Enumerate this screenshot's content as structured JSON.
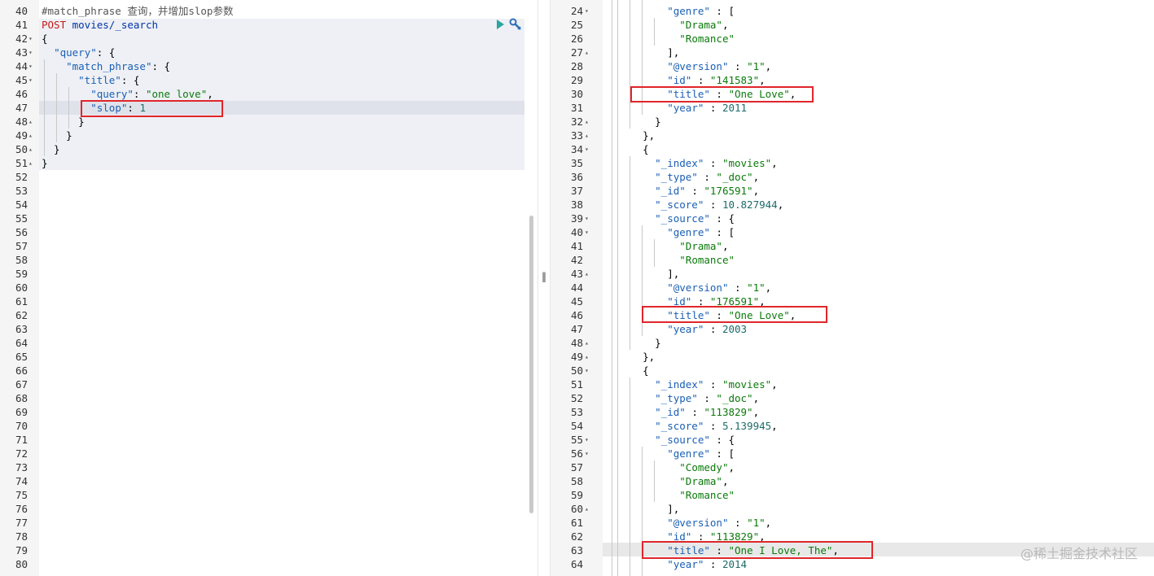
{
  "request_editor": {
    "lines": [
      {
        "n": "40",
        "fold": "",
        "tokens": [
          {
            "t": "#match_phrase 查询，并增加slop参数",
            "c": "comment"
          }
        ]
      },
      {
        "n": "41",
        "fold": "",
        "tokens": [
          {
            "t": "POST",
            "c": "method"
          },
          {
            "t": " movies/_search",
            "c": "url"
          }
        ]
      },
      {
        "n": "42",
        "fold": "▾",
        "tokens": [
          {
            "t": "{",
            "c": "plain"
          }
        ]
      },
      {
        "n": "43",
        "fold": "▾",
        "tokens": [
          {
            "t": "  ",
            "c": "plain"
          },
          {
            "t": "\"query\"",
            "c": "key"
          },
          {
            "t": ": {",
            "c": "plain"
          }
        ]
      },
      {
        "n": "44",
        "fold": "▾",
        "tokens": [
          {
            "t": "    ",
            "c": "plain"
          },
          {
            "t": "\"match_phrase\"",
            "c": "key"
          },
          {
            "t": ": {",
            "c": "plain"
          }
        ]
      },
      {
        "n": "45",
        "fold": "▾",
        "tokens": [
          {
            "t": "      ",
            "c": "plain"
          },
          {
            "t": "\"title\"",
            "c": "key"
          },
          {
            "t": ": {",
            "c": "plain"
          }
        ]
      },
      {
        "n": "46",
        "fold": "",
        "tokens": [
          {
            "t": "        ",
            "c": "plain"
          },
          {
            "t": "\"query\"",
            "c": "key"
          },
          {
            "t": ": ",
            "c": "plain"
          },
          {
            "t": "\"one love\"",
            "c": "str"
          },
          {
            "t": ",",
            "c": "plain"
          }
        ]
      },
      {
        "n": "47",
        "fold": "",
        "tokens": [
          {
            "t": "        ",
            "c": "plain"
          },
          {
            "t": "\"slop\"",
            "c": "key"
          },
          {
            "t": ": ",
            "c": "plain"
          },
          {
            "t": "1",
            "c": "num"
          }
        ]
      },
      {
        "n": "48",
        "fold": "▴",
        "tokens": [
          {
            "t": "      }",
            "c": "plain"
          }
        ]
      },
      {
        "n": "49",
        "fold": "▴",
        "tokens": [
          {
            "t": "    }",
            "c": "plain"
          }
        ]
      },
      {
        "n": "50",
        "fold": "▴",
        "tokens": [
          {
            "t": "  }",
            "c": "plain"
          }
        ]
      },
      {
        "n": "51",
        "fold": "▴",
        "tokens": [
          {
            "t": "}",
            "c": "plain"
          }
        ]
      },
      {
        "n": "52",
        "fold": "",
        "tokens": []
      },
      {
        "n": "53",
        "fold": "",
        "tokens": []
      },
      {
        "n": "54",
        "fold": "",
        "tokens": []
      },
      {
        "n": "55",
        "fold": "",
        "tokens": []
      },
      {
        "n": "56",
        "fold": "",
        "tokens": []
      },
      {
        "n": "57",
        "fold": "",
        "tokens": []
      },
      {
        "n": "58",
        "fold": "",
        "tokens": []
      },
      {
        "n": "59",
        "fold": "",
        "tokens": []
      },
      {
        "n": "60",
        "fold": "",
        "tokens": []
      },
      {
        "n": "61",
        "fold": "",
        "tokens": []
      },
      {
        "n": "62",
        "fold": "",
        "tokens": []
      },
      {
        "n": "63",
        "fold": "",
        "tokens": []
      },
      {
        "n": "64",
        "fold": "",
        "tokens": []
      },
      {
        "n": "65",
        "fold": "",
        "tokens": []
      },
      {
        "n": "66",
        "fold": "",
        "tokens": []
      },
      {
        "n": "67",
        "fold": "",
        "tokens": []
      },
      {
        "n": "68",
        "fold": "",
        "tokens": []
      },
      {
        "n": "69",
        "fold": "",
        "tokens": []
      },
      {
        "n": "70",
        "fold": "",
        "tokens": []
      },
      {
        "n": "71",
        "fold": "",
        "tokens": []
      },
      {
        "n": "72",
        "fold": "",
        "tokens": []
      },
      {
        "n": "73",
        "fold": "",
        "tokens": []
      },
      {
        "n": "74",
        "fold": "",
        "tokens": []
      },
      {
        "n": "75",
        "fold": "",
        "tokens": []
      },
      {
        "n": "76",
        "fold": "",
        "tokens": []
      },
      {
        "n": "77",
        "fold": "",
        "tokens": []
      },
      {
        "n": "78",
        "fold": "",
        "tokens": []
      },
      {
        "n": "79",
        "fold": "",
        "tokens": []
      },
      {
        "n": "80",
        "fold": "",
        "tokens": []
      }
    ],
    "icons": {
      "run": "play-icon",
      "settings": "wrench-icon"
    }
  },
  "response_viewer": {
    "lines": [
      {
        "n": "24",
        "fold": "▾",
        "tokens": [
          {
            "t": "        ",
            "c": "plain"
          },
          {
            "t": "\"genre\"",
            "c": "key"
          },
          {
            "t": " : [",
            "c": "plain"
          }
        ]
      },
      {
        "n": "25",
        "fold": "",
        "tokens": [
          {
            "t": "          ",
            "c": "plain"
          },
          {
            "t": "\"Drama\"",
            "c": "str"
          },
          {
            "t": ",",
            "c": "plain"
          }
        ]
      },
      {
        "n": "26",
        "fold": "",
        "tokens": [
          {
            "t": "          ",
            "c": "plain"
          },
          {
            "t": "\"Romance\"",
            "c": "str"
          }
        ]
      },
      {
        "n": "27",
        "fold": "▴",
        "tokens": [
          {
            "t": "        ],",
            "c": "plain"
          }
        ]
      },
      {
        "n": "28",
        "fold": "",
        "tokens": [
          {
            "t": "        ",
            "c": "plain"
          },
          {
            "t": "\"@version\"",
            "c": "key"
          },
          {
            "t": " : ",
            "c": "plain"
          },
          {
            "t": "\"1\"",
            "c": "str"
          },
          {
            "t": ",",
            "c": "plain"
          }
        ]
      },
      {
        "n": "29",
        "fold": "",
        "tokens": [
          {
            "t": "        ",
            "c": "plain"
          },
          {
            "t": "\"id\"",
            "c": "key"
          },
          {
            "t": " : ",
            "c": "plain"
          },
          {
            "t": "\"141583\"",
            "c": "str"
          },
          {
            "t": ",",
            "c": "plain"
          }
        ]
      },
      {
        "n": "30",
        "fold": "",
        "tokens": [
          {
            "t": "        ",
            "c": "plain"
          },
          {
            "t": "\"title\"",
            "c": "key"
          },
          {
            "t": " : ",
            "c": "plain"
          },
          {
            "t": "\"One Love\"",
            "c": "str"
          },
          {
            "t": ",",
            "c": "plain"
          }
        ]
      },
      {
        "n": "31",
        "fold": "",
        "tokens": [
          {
            "t": "        ",
            "c": "plain"
          },
          {
            "t": "\"year\"",
            "c": "key"
          },
          {
            "t": " : ",
            "c": "plain"
          },
          {
            "t": "2011",
            "c": "num"
          }
        ]
      },
      {
        "n": "32",
        "fold": "▴",
        "tokens": [
          {
            "t": "      }",
            "c": "plain"
          }
        ]
      },
      {
        "n": "33",
        "fold": "▴",
        "tokens": [
          {
            "t": "    },",
            "c": "plain"
          }
        ]
      },
      {
        "n": "34",
        "fold": "▾",
        "tokens": [
          {
            "t": "    {",
            "c": "plain"
          }
        ]
      },
      {
        "n": "35",
        "fold": "",
        "tokens": [
          {
            "t": "      ",
            "c": "plain"
          },
          {
            "t": "\"_index\"",
            "c": "key"
          },
          {
            "t": " : ",
            "c": "plain"
          },
          {
            "t": "\"movies\"",
            "c": "str"
          },
          {
            "t": ",",
            "c": "plain"
          }
        ]
      },
      {
        "n": "36",
        "fold": "",
        "tokens": [
          {
            "t": "      ",
            "c": "plain"
          },
          {
            "t": "\"_type\"",
            "c": "key"
          },
          {
            "t": " : ",
            "c": "plain"
          },
          {
            "t": "\"_doc\"",
            "c": "str"
          },
          {
            "t": ",",
            "c": "plain"
          }
        ]
      },
      {
        "n": "37",
        "fold": "",
        "tokens": [
          {
            "t": "      ",
            "c": "plain"
          },
          {
            "t": "\"_id\"",
            "c": "key"
          },
          {
            "t": " : ",
            "c": "plain"
          },
          {
            "t": "\"176591\"",
            "c": "str"
          },
          {
            "t": ",",
            "c": "plain"
          }
        ]
      },
      {
        "n": "38",
        "fold": "",
        "tokens": [
          {
            "t": "      ",
            "c": "plain"
          },
          {
            "t": "\"_score\"",
            "c": "key"
          },
          {
            "t": " : ",
            "c": "plain"
          },
          {
            "t": "10.827944",
            "c": "num"
          },
          {
            "t": ",",
            "c": "plain"
          }
        ]
      },
      {
        "n": "39",
        "fold": "▾",
        "tokens": [
          {
            "t": "      ",
            "c": "plain"
          },
          {
            "t": "\"_source\"",
            "c": "key"
          },
          {
            "t": " : {",
            "c": "plain"
          }
        ]
      },
      {
        "n": "40",
        "fold": "▾",
        "tokens": [
          {
            "t": "        ",
            "c": "plain"
          },
          {
            "t": "\"genre\"",
            "c": "key"
          },
          {
            "t": " : [",
            "c": "plain"
          }
        ]
      },
      {
        "n": "41",
        "fold": "",
        "tokens": [
          {
            "t": "          ",
            "c": "plain"
          },
          {
            "t": "\"Drama\"",
            "c": "str"
          },
          {
            "t": ",",
            "c": "plain"
          }
        ]
      },
      {
        "n": "42",
        "fold": "",
        "tokens": [
          {
            "t": "          ",
            "c": "plain"
          },
          {
            "t": "\"Romance\"",
            "c": "str"
          }
        ]
      },
      {
        "n": "43",
        "fold": "▴",
        "tokens": [
          {
            "t": "        ],",
            "c": "plain"
          }
        ]
      },
      {
        "n": "44",
        "fold": "",
        "tokens": [
          {
            "t": "        ",
            "c": "plain"
          },
          {
            "t": "\"@version\"",
            "c": "key"
          },
          {
            "t": " : ",
            "c": "plain"
          },
          {
            "t": "\"1\"",
            "c": "str"
          },
          {
            "t": ",",
            "c": "plain"
          }
        ]
      },
      {
        "n": "45",
        "fold": "",
        "tokens": [
          {
            "t": "        ",
            "c": "plain"
          },
          {
            "t": "\"id\"",
            "c": "key"
          },
          {
            "t": " : ",
            "c": "plain"
          },
          {
            "t": "\"176591\"",
            "c": "str"
          },
          {
            "t": ",",
            "c": "plain"
          }
        ]
      },
      {
        "n": "46",
        "fold": "",
        "tokens": [
          {
            "t": "        ",
            "c": "plain"
          },
          {
            "t": "\"title\"",
            "c": "key"
          },
          {
            "t": " : ",
            "c": "plain"
          },
          {
            "t": "\"One Love\"",
            "c": "str"
          },
          {
            "t": ",",
            "c": "plain"
          }
        ]
      },
      {
        "n": "47",
        "fold": "",
        "tokens": [
          {
            "t": "        ",
            "c": "plain"
          },
          {
            "t": "\"year\"",
            "c": "key"
          },
          {
            "t": " : ",
            "c": "plain"
          },
          {
            "t": "2003",
            "c": "num"
          }
        ]
      },
      {
        "n": "48",
        "fold": "▴",
        "tokens": [
          {
            "t": "      }",
            "c": "plain"
          }
        ]
      },
      {
        "n": "49",
        "fold": "▴",
        "tokens": [
          {
            "t": "    },",
            "c": "plain"
          }
        ]
      },
      {
        "n": "50",
        "fold": "▾",
        "tokens": [
          {
            "t": "    {",
            "c": "plain"
          }
        ]
      },
      {
        "n": "51",
        "fold": "",
        "tokens": [
          {
            "t": "      ",
            "c": "plain"
          },
          {
            "t": "\"_index\"",
            "c": "key"
          },
          {
            "t": " : ",
            "c": "plain"
          },
          {
            "t": "\"movies\"",
            "c": "str"
          },
          {
            "t": ",",
            "c": "plain"
          }
        ]
      },
      {
        "n": "52",
        "fold": "",
        "tokens": [
          {
            "t": "      ",
            "c": "plain"
          },
          {
            "t": "\"_type\"",
            "c": "key"
          },
          {
            "t": " : ",
            "c": "plain"
          },
          {
            "t": "\"_doc\"",
            "c": "str"
          },
          {
            "t": ",",
            "c": "plain"
          }
        ]
      },
      {
        "n": "53",
        "fold": "",
        "tokens": [
          {
            "t": "      ",
            "c": "plain"
          },
          {
            "t": "\"_id\"",
            "c": "key"
          },
          {
            "t": " : ",
            "c": "plain"
          },
          {
            "t": "\"113829\"",
            "c": "str"
          },
          {
            "t": ",",
            "c": "plain"
          }
        ]
      },
      {
        "n": "54",
        "fold": "",
        "tokens": [
          {
            "t": "      ",
            "c": "plain"
          },
          {
            "t": "\"_score\"",
            "c": "key"
          },
          {
            "t": " : ",
            "c": "plain"
          },
          {
            "t": "5.139945",
            "c": "num"
          },
          {
            "t": ",",
            "c": "plain"
          }
        ]
      },
      {
        "n": "55",
        "fold": "▾",
        "tokens": [
          {
            "t": "      ",
            "c": "plain"
          },
          {
            "t": "\"_source\"",
            "c": "key"
          },
          {
            "t": " : {",
            "c": "plain"
          }
        ]
      },
      {
        "n": "56",
        "fold": "▾",
        "tokens": [
          {
            "t": "        ",
            "c": "plain"
          },
          {
            "t": "\"genre\"",
            "c": "key"
          },
          {
            "t": " : [",
            "c": "plain"
          }
        ]
      },
      {
        "n": "57",
        "fold": "",
        "tokens": [
          {
            "t": "          ",
            "c": "plain"
          },
          {
            "t": "\"Comedy\"",
            "c": "str"
          },
          {
            "t": ",",
            "c": "plain"
          }
        ]
      },
      {
        "n": "58",
        "fold": "",
        "tokens": [
          {
            "t": "          ",
            "c": "plain"
          },
          {
            "t": "\"Drama\"",
            "c": "str"
          },
          {
            "t": ",",
            "c": "plain"
          }
        ]
      },
      {
        "n": "59",
        "fold": "",
        "tokens": [
          {
            "t": "          ",
            "c": "plain"
          },
          {
            "t": "\"Romance\"",
            "c": "str"
          }
        ]
      },
      {
        "n": "60",
        "fold": "▴",
        "tokens": [
          {
            "t": "        ],",
            "c": "plain"
          }
        ]
      },
      {
        "n": "61",
        "fold": "",
        "tokens": [
          {
            "t": "        ",
            "c": "plain"
          },
          {
            "t": "\"@version\"",
            "c": "key"
          },
          {
            "t": " : ",
            "c": "plain"
          },
          {
            "t": "\"1\"",
            "c": "str"
          },
          {
            "t": ",",
            "c": "plain"
          }
        ]
      },
      {
        "n": "62",
        "fold": "",
        "tokens": [
          {
            "t": "        ",
            "c": "plain"
          },
          {
            "t": "\"id\"",
            "c": "key"
          },
          {
            "t": " : ",
            "c": "plain"
          },
          {
            "t": "\"113829\"",
            "c": "str"
          },
          {
            "t": ",",
            "c": "plain"
          }
        ]
      },
      {
        "n": "63",
        "fold": "",
        "tokens": [
          {
            "t": "        ",
            "c": "plain"
          },
          {
            "t": "\"title\"",
            "c": "key"
          },
          {
            "t": " : ",
            "c": "plain"
          },
          {
            "t": "\"One I Love, The\"",
            "c": "str"
          },
          {
            "t": ",",
            "c": "plain"
          }
        ]
      },
      {
        "n": "64",
        "fold": "",
        "tokens": [
          {
            "t": "        ",
            "c": "plain"
          },
          {
            "t": "\"year\"",
            "c": "key"
          },
          {
            "t": " : ",
            "c": "plain"
          },
          {
            "t": "2014",
            "c": "num"
          }
        ]
      }
    ]
  },
  "divider": {
    "handle_glyph": "‖"
  },
  "watermark": {
    "text": "@稀土掘金技术社区"
  },
  "colors": {
    "highlight_box": "#e0262b",
    "method": "#c41a16",
    "key": "#1a5fb4",
    "string": "#0b7a0b",
    "number": "#1d6b6b"
  }
}
